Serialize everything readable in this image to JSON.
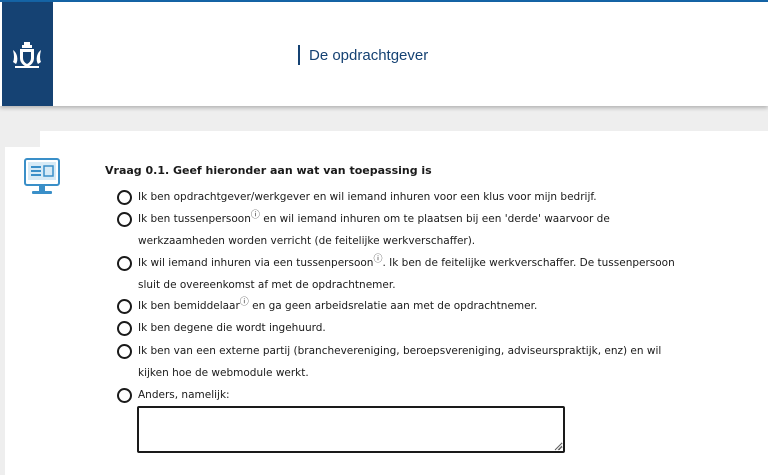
{
  "header": {
    "title": "De opdrachtgever",
    "accent_color": "#154273",
    "logo_icon": "coat-of-arms-icon"
  },
  "question": {
    "icon": "computer-form-icon",
    "title": "Vraag 0.1. Geef hieronder aan wat van toepassing is",
    "options": [
      {
        "parts": [
          "Ik ben opdrachtgever/werkgever en wil iemand inhuren voor een klus voor mijn bedrijf."
        ]
      },
      {
        "parts": [
          "Ik ben tussenpersoon",
          " en wil iemand inhuren om te plaatsen bij een 'derde' waarvoor de\nwerkzaamheden worden verricht (de feitelijke werkverschaffer)."
        ]
      },
      {
        "parts": [
          "Ik wil iemand inhuren via een tussenpersoon",
          ". Ik ben de feitelijke werkverschaffer. De tussenpersoon\nsluit de overeenkomst af met de opdrachtnemer."
        ]
      },
      {
        "parts": [
          "Ik ben bemiddelaar",
          " en ga geen arbeidsrelatie aan met de opdrachtnemer."
        ]
      },
      {
        "parts": [
          "Ik ben degene die wordt ingehuurd."
        ]
      },
      {
        "parts": [
          "Ik ben van een externe partij (branchevereniging, beroepsvereniging, adviseurspraktijk, enz) en wil\nkijken hoe de webmodule werkt."
        ]
      },
      {
        "parts": [
          "Anders, namelijk:"
        ]
      }
    ],
    "info_marker": "ⓘ",
    "other_value": ""
  }
}
